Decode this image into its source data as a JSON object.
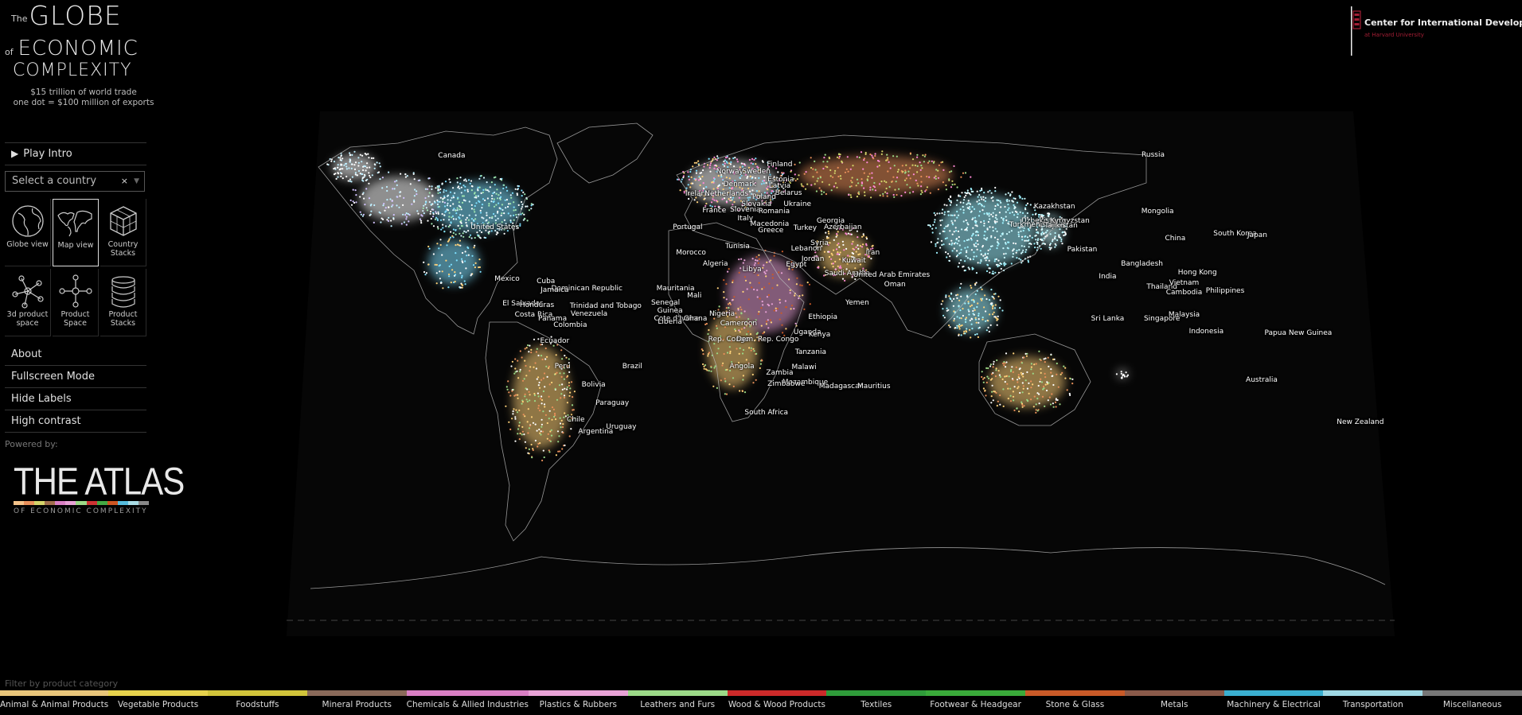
{
  "title": {
    "the": "The",
    "globe": "GLOBE",
    "of": "of",
    "economic": "ECONOMIC",
    "complexity": "COMPLEXITY",
    "tagline1": "$15 trillion of world trade",
    "tagline2": "one dot = $100 million of exports"
  },
  "menu": {
    "play_intro": "Play Intro",
    "select_placeholder": "Select a country",
    "select_clear": "×",
    "about": "About",
    "fullscreen": "Fullscreen Mode",
    "hide_labels": "Hide Labels",
    "high_contrast": "High contrast",
    "powered_by": "Powered by:"
  },
  "views": [
    {
      "id": "globe",
      "label": "Globe view",
      "icon": "globe-icon",
      "active": false
    },
    {
      "id": "map",
      "label": "Map view",
      "icon": "map-icon",
      "active": true
    },
    {
      "id": "stacks",
      "label": "Country Stacks",
      "icon": "cube-icon",
      "active": false
    },
    {
      "id": "3dspace",
      "label": "3d product space",
      "icon": "network-3d-icon",
      "active": false
    },
    {
      "id": "space",
      "label": "Product Space",
      "icon": "network-icon",
      "active": false
    },
    {
      "id": "pstacks",
      "label": "Product Stacks",
      "icon": "coins-icon",
      "active": false
    }
  ],
  "atlas": {
    "name": "THE ATLAS",
    "sub": "OF ECONOMIC COMPLEXITY",
    "stripe_colors": [
      "#f4c38a",
      "#e88f5a",
      "#d4d46a",
      "#a06e4c",
      "#d97fc4",
      "#e8a2d6",
      "#9bd987",
      "#cc3333",
      "#44aa44",
      "#cc5522",
      "#55bbdd",
      "#aadde6",
      "#888888"
    ]
  },
  "cid": {
    "name": "Center for International Development",
    "at": "at Harvard University",
    "accent": "#a41e34"
  },
  "filter_title": "Filter by product category",
  "categories": [
    {
      "label": "Animal & Animal Products",
      "color": "#e8c57a"
    },
    {
      "label": "Vegetable Products",
      "color": "#e6d24c"
    },
    {
      "label": "Foodstuffs",
      "color": "#d1c43a"
    },
    {
      "label": "Mineral Products",
      "color": "#8a6a5a"
    },
    {
      "label": "Chemicals & Allied Industries",
      "color": "#d97fc4"
    },
    {
      "label": "Plastics & Rubbers",
      "color": "#e8a2d6"
    },
    {
      "label": "Leathers and Furs",
      "color": "#9bd987"
    },
    {
      "label": "Wood & Wood Products",
      "color": "#cc2a2a"
    },
    {
      "label": "Textiles",
      "color": "#2f9c3a"
    },
    {
      "label": "Footwear & Headgear",
      "color": "#3aaa3a"
    },
    {
      "label": "Stone & Glass",
      "color": "#c95a28"
    },
    {
      "label": "Metals",
      "color": "#8a5a4a"
    },
    {
      "label": "Machinery & Electrical",
      "color": "#3aafd0"
    },
    {
      "label": "Transportation",
      "color": "#9fd8e4"
    },
    {
      "label": "Miscellaneous",
      "color": "#777777"
    }
  ],
  "country_labels": [
    {
      "name": "Canada",
      "rx": 0.149,
      "ry": 0.084
    },
    {
      "name": "United States",
      "rx": 0.188,
      "ry": 0.22
    },
    {
      "name": "Russia",
      "rx": 0.782,
      "ry": 0.083
    },
    {
      "name": "Mongolia",
      "rx": 0.786,
      "ry": 0.19
    },
    {
      "name": "China",
      "rx": 0.802,
      "ry": 0.24
    },
    {
      "name": "South Korea",
      "rx": 0.856,
      "ry": 0.232
    },
    {
      "name": "Japan",
      "rx": 0.876,
      "ry": 0.234
    },
    {
      "name": "Kazakhstan",
      "rx": 0.693,
      "ry": 0.181
    },
    {
      "name": "Uzbekistan",
      "rx": 0.681,
      "ry": 0.208
    },
    {
      "name": "Turkmenistan",
      "rx": 0.674,
      "ry": 0.215
    },
    {
      "name": "Kyrgyzstan",
      "rx": 0.707,
      "ry": 0.207
    },
    {
      "name": "Tajikistan",
      "rx": 0.699,
      "ry": 0.217
    },
    {
      "name": "Pakistan",
      "rx": 0.718,
      "ry": 0.262
    },
    {
      "name": "India",
      "rx": 0.741,
      "ry": 0.313
    },
    {
      "name": "Sri Lanka",
      "rx": 0.741,
      "ry": 0.392
    },
    {
      "name": "Bangladesh",
      "rx": 0.772,
      "ry": 0.288
    },
    {
      "name": "Hong Kong",
      "rx": 0.822,
      "ry": 0.306
    },
    {
      "name": "Thailand",
      "rx": 0.79,
      "ry": 0.332
    },
    {
      "name": "Vietnam",
      "rx": 0.81,
      "ry": 0.325
    },
    {
      "name": "Cambodia",
      "rx": 0.81,
      "ry": 0.343
    },
    {
      "name": "Philippines",
      "rx": 0.847,
      "ry": 0.34
    },
    {
      "name": "Malaysia",
      "rx": 0.81,
      "ry": 0.385
    },
    {
      "name": "Singapore",
      "rx": 0.79,
      "ry": 0.392
    },
    {
      "name": "Indonesia",
      "rx": 0.83,
      "ry": 0.417
    },
    {
      "name": "Papua New Guinea",
      "rx": 0.913,
      "ry": 0.42
    },
    {
      "name": "Australia",
      "rx": 0.88,
      "ry": 0.509
    },
    {
      "name": "New Zealand",
      "rx": 0.969,
      "ry": 0.588
    },
    {
      "name": "Norway",
      "rx": 0.4,
      "ry": 0.114
    },
    {
      "name": "Sweden",
      "rx": 0.424,
      "ry": 0.114
    },
    {
      "name": "Finland",
      "rx": 0.445,
      "ry": 0.1
    },
    {
      "name": "Estonia",
      "rx": 0.446,
      "ry": 0.13
    },
    {
      "name": "Latvia",
      "rx": 0.445,
      "ry": 0.141
    },
    {
      "name": "Denmark",
      "rx": 0.409,
      "ry": 0.139
    },
    {
      "name": "Belarus",
      "rx": 0.453,
      "ry": 0.155
    },
    {
      "name": "Ireland",
      "rx": 0.371,
      "ry": 0.157
    },
    {
      "name": "Netherlands",
      "rx": 0.397,
      "ry": 0.157
    },
    {
      "name": "Poland",
      "rx": 0.431,
      "ry": 0.163
    },
    {
      "name": "Ukraine",
      "rx": 0.461,
      "ry": 0.176
    },
    {
      "name": "Slovakia",
      "rx": 0.424,
      "ry": 0.176
    },
    {
      "name": "France",
      "rx": 0.386,
      "ry": 0.188
    },
    {
      "name": "Slovenia",
      "rx": 0.414,
      "ry": 0.187
    },
    {
      "name": "Romania",
      "rx": 0.44,
      "ry": 0.189
    },
    {
      "name": "Italy",
      "rx": 0.414,
      "ry": 0.203
    },
    {
      "name": "Georgia",
      "rx": 0.491,
      "ry": 0.207
    },
    {
      "name": "Macedonia",
      "rx": 0.436,
      "ry": 0.214
    },
    {
      "name": "Azerbaijan",
      "rx": 0.502,
      "ry": 0.22
    },
    {
      "name": "Portugal",
      "rx": 0.362,
      "ry": 0.219
    },
    {
      "name": "Greece",
      "rx": 0.437,
      "ry": 0.225
    },
    {
      "name": "Turkey",
      "rx": 0.468,
      "ry": 0.221
    },
    {
      "name": "Syria",
      "rx": 0.481,
      "ry": 0.249
    },
    {
      "name": "Lebanon",
      "rx": 0.469,
      "ry": 0.26
    },
    {
      "name": "Jordan",
      "rx": 0.475,
      "ry": 0.279
    },
    {
      "name": "Iran",
      "rx": 0.529,
      "ry": 0.267
    },
    {
      "name": "Kuwait",
      "rx": 0.512,
      "ry": 0.283
    },
    {
      "name": "Morocco",
      "rx": 0.365,
      "ry": 0.267
    },
    {
      "name": "Algeria",
      "rx": 0.387,
      "ry": 0.288
    },
    {
      "name": "Tunisia",
      "rx": 0.407,
      "ry": 0.256
    },
    {
      "name": "Libya",
      "rx": 0.42,
      "ry": 0.299
    },
    {
      "name": "Egypt",
      "rx": 0.46,
      "ry": 0.29
    },
    {
      "name": "Saudi Arabia",
      "rx": 0.506,
      "ry": 0.307
    },
    {
      "name": "United Arab Emirates",
      "rx": 0.546,
      "ry": 0.31
    },
    {
      "name": "Oman",
      "rx": 0.549,
      "ry": 0.328
    },
    {
      "name": "Yemen",
      "rx": 0.515,
      "ry": 0.362
    },
    {
      "name": "Mauritania",
      "rx": 0.351,
      "ry": 0.335
    },
    {
      "name": "Mali",
      "rx": 0.368,
      "ry": 0.349
    },
    {
      "name": "Senegal",
      "rx": 0.342,
      "ry": 0.363
    },
    {
      "name": "Guinea",
      "rx": 0.346,
      "ry": 0.378
    },
    {
      "name": "Cote d'Ivoire",
      "rx": 0.352,
      "ry": 0.392
    },
    {
      "name": "Liberia",
      "rx": 0.346,
      "ry": 0.399
    },
    {
      "name": "Ghana",
      "rx": 0.369,
      "ry": 0.392
    },
    {
      "name": "Nigeria",
      "rx": 0.393,
      "ry": 0.384
    },
    {
      "name": "Cameroon",
      "rx": 0.408,
      "ry": 0.401
    },
    {
      "name": "Ethiopia",
      "rx": 0.484,
      "ry": 0.389
    },
    {
      "name": "Uganda",
      "rx": 0.47,
      "ry": 0.418
    },
    {
      "name": "Kenya",
      "rx": 0.481,
      "ry": 0.423
    },
    {
      "name": "Rep. Congo",
      "rx": 0.399,
      "ry": 0.431
    },
    {
      "name": "Dem. Rep. Congo",
      "rx": 0.434,
      "ry": 0.431
    },
    {
      "name": "Tanzania",
      "rx": 0.473,
      "ry": 0.456
    },
    {
      "name": "Angola",
      "rx": 0.411,
      "ry": 0.482
    },
    {
      "name": "Zambia",
      "rx": 0.445,
      "ry": 0.494
    },
    {
      "name": "Malawi",
      "rx": 0.467,
      "ry": 0.484
    },
    {
      "name": "Mozambique",
      "rx": 0.468,
      "ry": 0.513
    },
    {
      "name": "Zimbabwe",
      "rx": 0.451,
      "ry": 0.516
    },
    {
      "name": "Madagascar",
      "rx": 0.5,
      "ry": 0.52
    },
    {
      "name": "Mauritius",
      "rx": 0.53,
      "ry": 0.52
    },
    {
      "name": "South Africa",
      "rx": 0.433,
      "ry": 0.57
    },
    {
      "name": "Mexico",
      "rx": 0.199,
      "ry": 0.317
    },
    {
      "name": "Cuba",
      "rx": 0.234,
      "ry": 0.322
    },
    {
      "name": "Dominican Republic",
      "rx": 0.271,
      "ry": 0.336
    },
    {
      "name": "Jamaica",
      "rx": 0.242,
      "ry": 0.338
    },
    {
      "name": "El Salvador",
      "rx": 0.213,
      "ry": 0.364
    },
    {
      "name": "Honduras",
      "rx": 0.226,
      "ry": 0.367
    },
    {
      "name": "Costa Rica",
      "rx": 0.223,
      "ry": 0.385
    },
    {
      "name": "Panama",
      "rx": 0.24,
      "ry": 0.393
    },
    {
      "name": "Trinidad and Tobago",
      "rx": 0.288,
      "ry": 0.369
    },
    {
      "name": "Venezuela",
      "rx": 0.273,
      "ry": 0.384
    },
    {
      "name": "Colombia",
      "rx": 0.256,
      "ry": 0.404
    },
    {
      "name": "Ecuador",
      "rx": 0.242,
      "ry": 0.435
    },
    {
      "name": "Peru",
      "rx": 0.249,
      "ry": 0.482
    },
    {
      "name": "Brazil",
      "rx": 0.312,
      "ry": 0.482
    },
    {
      "name": "Bolivia",
      "rx": 0.277,
      "ry": 0.518
    },
    {
      "name": "Paraguay",
      "rx": 0.294,
      "ry": 0.552
    },
    {
      "name": "Chile",
      "rx": 0.261,
      "ry": 0.584
    },
    {
      "name": "Argentina",
      "rx": 0.279,
      "ry": 0.606
    },
    {
      "name": "Uruguay",
      "rx": 0.302,
      "ry": 0.597
    }
  ]
}
